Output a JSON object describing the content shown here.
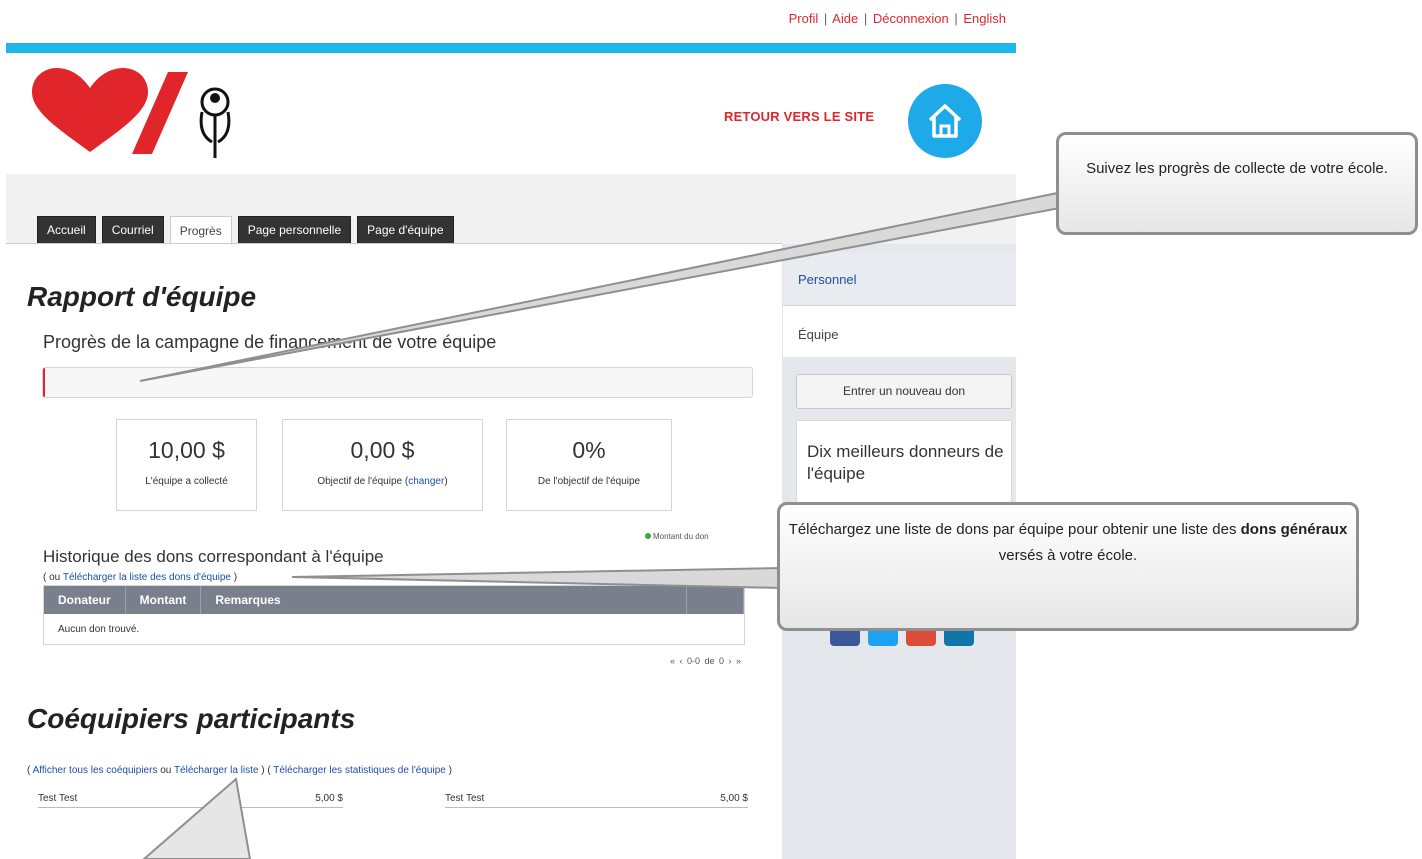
{
  "top_links": {
    "profil": "Profil",
    "aide": "Aide",
    "deconnexion": "Déconnexion",
    "english": "English",
    "separator": "|"
  },
  "header": {
    "retour": "RETOUR VERS LE SITE"
  },
  "tabs": [
    {
      "label": "Accueil",
      "active": false
    },
    {
      "label": "Courriel",
      "active": false
    },
    {
      "label": "Progrès",
      "active": true
    },
    {
      "label": "Page personnelle",
      "active": false
    },
    {
      "label": "Page d'équipe",
      "active": false
    }
  ],
  "report": {
    "title": "Rapport d'équipe",
    "subtitle": "Progrès de la campagne de financement de votre équipe",
    "progress_fraction": 0.003,
    "stats": [
      {
        "value": "10,00 $",
        "label_before": "L'équipe a collecté",
        "link": "",
        "label_after": ""
      },
      {
        "value": "0,00 $",
        "label_before": "Objectif de l'équipe (",
        "link": "changer",
        "label_after": ")"
      },
      {
        "value": "0%",
        "label_before": "De l'objectif de l'équipe",
        "link": "",
        "label_after": ""
      }
    ],
    "legend": "Montant du don"
  },
  "history": {
    "title": "Historique des dons correspondant à l'équipe",
    "link_prefix": "( ou ",
    "link": "Télécharger la liste des dons d'équipe",
    "link_suffix": " )",
    "columns": [
      "Donateur",
      "Montant",
      "Remarques"
    ],
    "empty": "Aucun don trouvé.",
    "pager": "« ‹ 0-0 de 0 › »"
  },
  "teammates": {
    "title": "Coéquipiers participants",
    "l1_prefix": "( ",
    "l1": "Afficher tous les coéquipiers",
    "l1_mid": " ou ",
    "l2": "Télécharger la liste",
    "l2_suffix": " ) ( ",
    "l3": "Télécharger les statistiques de l'équipe",
    "l3_suffix": " )",
    "members": [
      {
        "name": "Test Test",
        "amount": "5,00 $"
      },
      {
        "name": "Test Test",
        "amount": "5,00 $"
      }
    ]
  },
  "sidebar": {
    "personnel": "Personnel",
    "equipe": "Équipe",
    "new_donation": "Entrer un nouveau don",
    "top_donors": "Dix meilleurs donneurs de l'équipe"
  },
  "callouts": {
    "c1": "Suivez les progrès de collecte de votre école.",
    "c2_before": "Téléchargez une liste de dons par équipe pour obtenir une liste des ",
    "c2_bold": "dons généraux",
    "c2_after": " versés à votre école."
  },
  "colors": {
    "accent_red": "#e0262b",
    "blue_bar": "#1fb8ea",
    "home_blue": "#1ea9e8",
    "table_header": "#7a7f8d"
  }
}
